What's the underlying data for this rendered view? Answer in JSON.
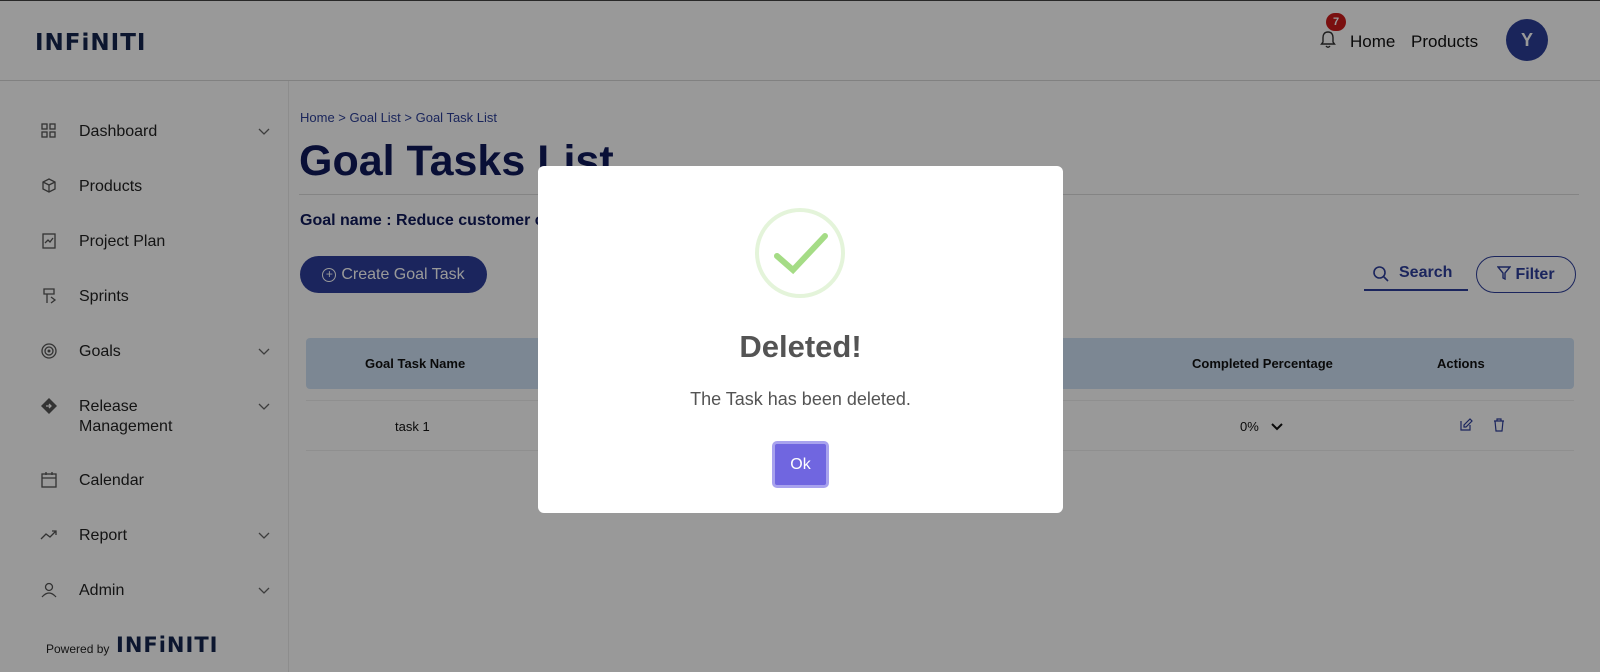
{
  "header": {
    "logo": "INFiNITI",
    "notification_count": "7",
    "nav": {
      "home": "Home",
      "products": "Products"
    },
    "avatar_initial": "Y"
  },
  "sidebar": {
    "items": [
      {
        "label": "Dashboard",
        "icon": "grid-icon",
        "chevron": true
      },
      {
        "label": "Products",
        "icon": "box-icon",
        "chevron": false
      },
      {
        "label": "Project Plan",
        "icon": "clipboard-chart-icon",
        "chevron": false
      },
      {
        "label": "Sprints",
        "icon": "sprint-icon",
        "chevron": false
      },
      {
        "label": "Goals",
        "icon": "target-icon",
        "chevron": true
      },
      {
        "label": "Release Management",
        "icon": "diamond-arrow-icon",
        "chevron": true
      },
      {
        "label": "Calendar",
        "icon": "calendar-icon",
        "chevron": false
      },
      {
        "label": "Report",
        "icon": "trending-up-icon",
        "chevron": true
      },
      {
        "label": "Admin",
        "icon": "user-icon",
        "chevron": true
      }
    ],
    "powered_by": "Powered by",
    "powered_logo": "INFiNITI"
  },
  "main": {
    "breadcrumb": "Home > Goal List > Goal Task List",
    "title": "Goal Tasks List",
    "goal_name": "Goal name : Reduce customer ch",
    "create_button": "Create Goal Task",
    "search_label": "Search",
    "filter_label": "Filter",
    "table": {
      "headers": {
        "name": "Goal Task Name",
        "completed": "Completed Percentage",
        "actions": "Actions"
      },
      "rows": [
        {
          "name": "task 1",
          "completed": "0%"
        }
      ]
    }
  },
  "modal": {
    "title": "Deleted!",
    "text": "The Task has been deleted.",
    "ok_label": "Ok"
  },
  "colors": {
    "primary": "#2e3f9c",
    "title": "#0f1a5a",
    "badge": "#cc1b1b",
    "ok_button": "#7066e0",
    "success": "#a5dc86",
    "table_header": "#cfe2f6"
  }
}
